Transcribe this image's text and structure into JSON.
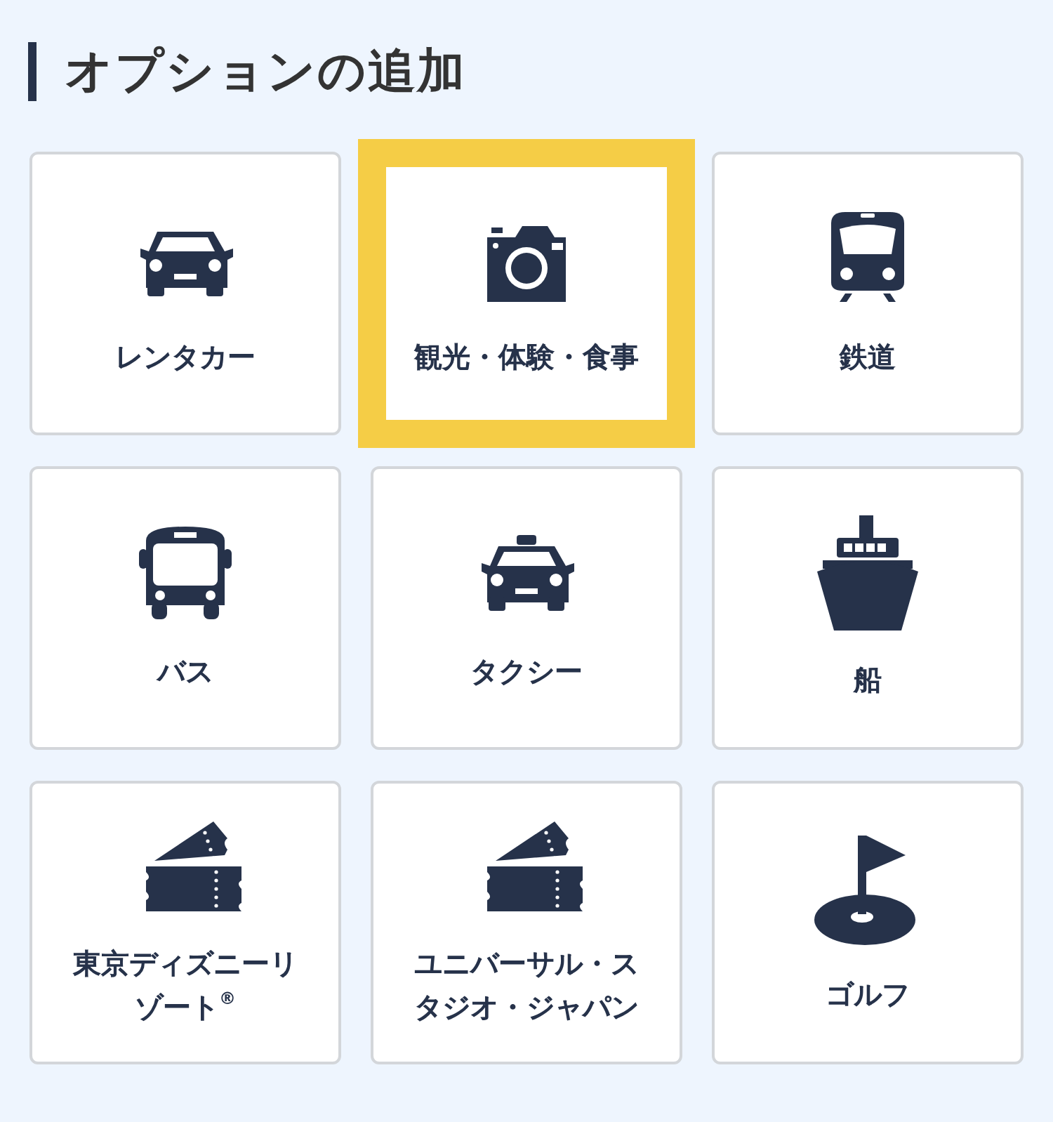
{
  "title": "オプションの追加",
  "options": [
    {
      "label": "レンタカー",
      "kind": "car",
      "selected": false
    },
    {
      "label": "観光・体験・食事",
      "kind": "camera",
      "selected": true
    },
    {
      "label": "鉄道",
      "kind": "train",
      "selected": false
    },
    {
      "label": "バス",
      "kind": "bus",
      "selected": false
    },
    {
      "label": "タクシー",
      "kind": "taxi",
      "selected": false
    },
    {
      "label": "船",
      "kind": "ship",
      "selected": false
    },
    {
      "label": "東京ディズニーリゾート$^{®}$",
      "kind": "ticket",
      "selected": false
    },
    {
      "label": "ユニバーサル・スタジオ・ジャパン",
      "kind": "ticket",
      "selected": false
    },
    {
      "label": "ゴルフ",
      "kind": "golf",
      "selected": false
    }
  ]
}
